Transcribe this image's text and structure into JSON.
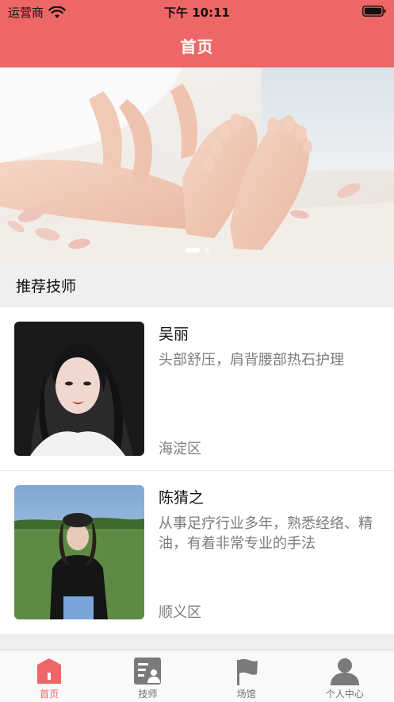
{
  "status_bar": {
    "carrier": "运营商",
    "time": "下午 10:11"
  },
  "nav": {
    "title": "首页"
  },
  "banner": {
    "image": "massage-feet-photo",
    "slides": 2,
    "active_slide": 1
  },
  "section": {
    "title": "推荐技师"
  },
  "technicians": [
    {
      "name": "吴丽",
      "desc": "头部舒压，肩背腰部热石护理",
      "area": "海淀区",
      "photo": "portrait-woman-dark-hair"
    },
    {
      "name": "陈猜之",
      "desc": "从事足疗行业多年，熟悉经络、精油，有着非常专业的手法",
      "area": "顺义区",
      "photo": "portrait-woman-outdoor-cap"
    }
  ],
  "tabs": [
    {
      "label": "首页",
      "icon": "home-icon",
      "active": true
    },
    {
      "label": "技师",
      "icon": "technician-icon",
      "active": false
    },
    {
      "label": "场馆",
      "icon": "flag-icon",
      "active": false
    },
    {
      "label": "个人中心",
      "icon": "person-icon",
      "active": false
    }
  ],
  "colors": {
    "brand": "#ee6767",
    "text_secondary": "#7d7d7d",
    "section_bg": "#efefef"
  }
}
